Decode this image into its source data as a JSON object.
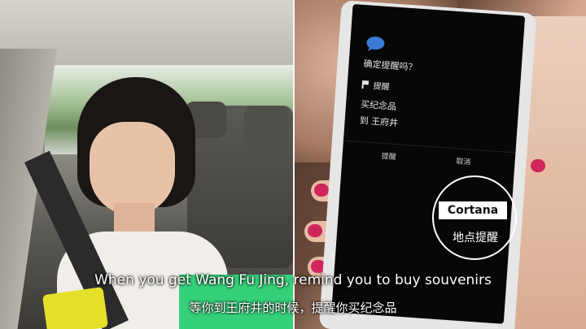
{
  "scene": {
    "left_photo": "woman-in-car-using-phone",
    "right_photo": "hand-holding-phone-cortana"
  },
  "phone_screen": {
    "question": "确定提醒吗？",
    "reminder_header": "提醒",
    "item_line_1": "买纪念品",
    "item_line_2": "到 王府井",
    "ok_button": "提醒",
    "cancel_button": "取消"
  },
  "badge": {
    "title": "Cortana",
    "subtitle": "地点提醒"
  },
  "subtitles": {
    "english": "When you get Wang Fu Jing, remind you to buy souvenirs",
    "chinese": "等你到王府井的时候，提醒你买纪念品"
  },
  "colors": {
    "nail_polish": "#d0265e",
    "phone_yellow": "#e5e02a",
    "phone_green": "#35d07a",
    "cortana_blue": "#3a7bd5"
  }
}
